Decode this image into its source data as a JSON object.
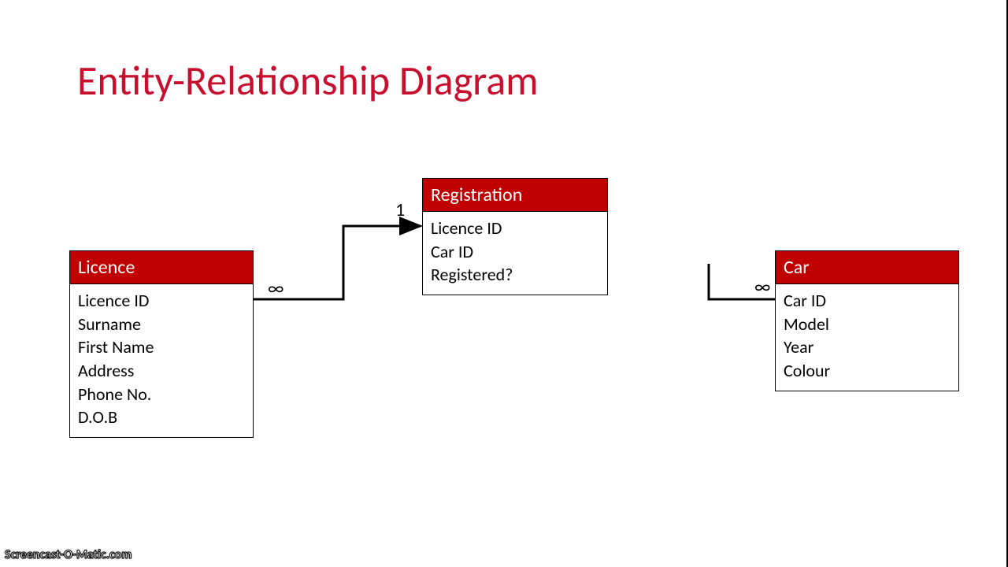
{
  "title": "Entity-Relationship Diagram",
  "entities": {
    "licence": {
      "name": "Licence",
      "fields": [
        "Licence ID",
        "Surname",
        "First Name",
        "Address",
        "Phone No.",
        "D.O.B"
      ]
    },
    "registration": {
      "name": "Registration",
      "fields": [
        "Licence ID",
        "Car ID",
        "Registered?"
      ]
    },
    "car": {
      "name": "Car",
      "fields": [
        "Car ID",
        "Model",
        "Year",
        "Colour"
      ]
    }
  },
  "cardinality": {
    "licence_side": "∞",
    "registration_side": "1",
    "car_side": "∞"
  },
  "watermark": "Screencast-O-Matic.com"
}
